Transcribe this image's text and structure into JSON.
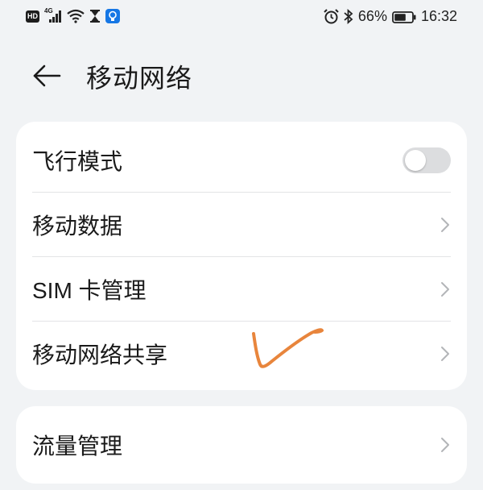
{
  "status_bar": {
    "hd_badge": "HD",
    "network_type": "4G",
    "battery_percent": "66%",
    "time": "16:32",
    "icons": [
      "hd-icon",
      "signal-icon",
      "wifi-icon",
      "hourglass-icon",
      "bulb-icon",
      "alarm-icon",
      "bluetooth-icon",
      "battery-icon"
    ],
    "battery_level": 0.66
  },
  "header": {
    "title": "移动网络",
    "back_icon": "back-arrow-icon"
  },
  "settings": {
    "group1": [
      {
        "label": "飞行模式",
        "control": "toggle",
        "toggle_on": false
      },
      {
        "label": "移动数据",
        "control": "chevron"
      },
      {
        "label": "SIM 卡管理",
        "control": "chevron"
      },
      {
        "label": "移动网络共享",
        "control": "chevron"
      }
    ],
    "group2": [
      {
        "label": "流量管理",
        "control": "chevron"
      }
    ]
  },
  "colors": {
    "background": "#f1f3f5",
    "card": "#ffffff",
    "toggle_off": "#dcdddf",
    "chevron": "#b3b5b8",
    "annotation": "#e8853c",
    "hint_bulb": "#1677e5"
  },
  "annotation": {
    "icon": "checkmark-scribble-icon"
  }
}
